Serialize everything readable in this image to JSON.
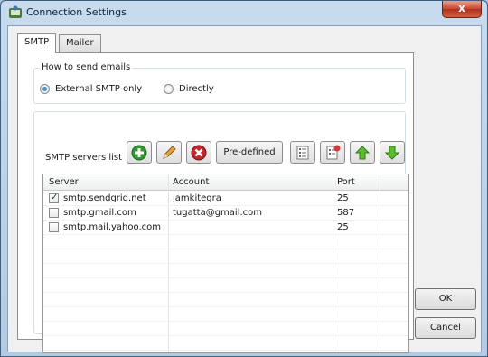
{
  "window": {
    "title": "Connection Settings",
    "close_label": "x"
  },
  "tabs": [
    {
      "label": "SMTP"
    },
    {
      "label": "Mailer"
    }
  ],
  "send_group": {
    "legend": "How to send emails",
    "options": [
      {
        "label": "External SMTP only",
        "selected": true
      },
      {
        "label": "Directly",
        "selected": false
      }
    ]
  },
  "servers": {
    "label": "SMTP servers list",
    "predefined_label": "Pre-defined",
    "icons": [
      "add-icon",
      "edit-pencil-icon",
      "delete-icon",
      "list-icon",
      "list-remove-icon",
      "move-up-icon",
      "move-down-icon"
    ],
    "columns": [
      "Server",
      "Account",
      "Port"
    ],
    "rows": [
      {
        "checked": true,
        "server": "smtp.sendgrid.net",
        "account": "jamkitegra",
        "port": "25"
      },
      {
        "checked": false,
        "server": "smtp.gmail.com",
        "account": "tugatta@gmail.com",
        "port": "587"
      },
      {
        "checked": false,
        "server": "smtp.mail.yahoo.com",
        "account": "",
        "port": "25"
      }
    ]
  },
  "buttons": {
    "ok": "OK",
    "cancel": "Cancel"
  },
  "colors": {
    "add": "#2f9a2f",
    "delete": "#c8262a",
    "arrows": "#5bbf2a",
    "radio_selected": "#1764a8"
  }
}
